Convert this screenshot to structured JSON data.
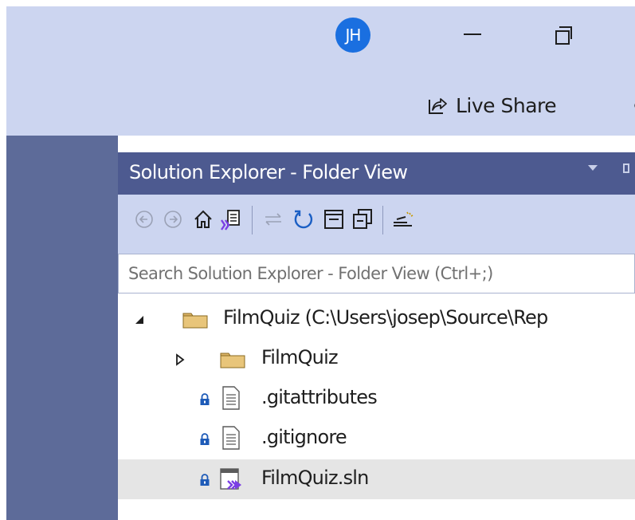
{
  "window": {
    "user_initials": "JH",
    "live_share_label": "Live Share"
  },
  "panel": {
    "title": "Solution Explorer - Folder View",
    "search_placeholder": "Search Solution Explorer - Folder View (Ctrl+;)"
  },
  "toolbar": {
    "icons": [
      "back-icon",
      "forward-icon",
      "home-icon",
      "switch-views-icon",
      "sync-icon",
      "refresh-icon",
      "collapse-all-icon",
      "show-all-files-icon",
      "properties-icon"
    ]
  },
  "tree": {
    "items": [
      {
        "label": "FilmQuiz (C:\\Users\\josep\\Source\\Rep",
        "type": "folder",
        "expanded": true
      },
      {
        "label": "FilmQuiz",
        "type": "folder",
        "expanded": false
      },
      {
        "label": ".gitattributes",
        "type": "file",
        "locked": true
      },
      {
        "label": ".gitignore",
        "type": "file",
        "locked": true
      },
      {
        "label": "FilmQuiz.sln",
        "type": "solution",
        "locked": true,
        "selected": true
      }
    ]
  },
  "colors": {
    "title_bar": "#ccd5f0",
    "panel_header": "#4d5a90",
    "side_strip": "#5d6b99",
    "avatar": "#1a6fe0",
    "folder": "#dcb467",
    "lock": "#1e5bb8",
    "selected_row": "#e5e5e5"
  }
}
